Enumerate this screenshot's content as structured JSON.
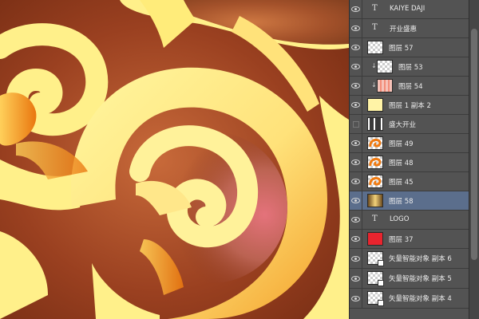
{
  "layers": [
    {
      "name": "KAIYE DAJI",
      "kind": "text",
      "visible": true
    },
    {
      "name": "开业盛惠",
      "kind": "text",
      "visible": true
    },
    {
      "name": "图层 57",
      "kind": "image",
      "thumb": "checker",
      "visible": true
    },
    {
      "name": "图层 53",
      "kind": "image",
      "thumb": "checker",
      "clipped": true,
      "visible": true
    },
    {
      "name": "图层 54",
      "kind": "image",
      "thumb": "pink-stripes",
      "clipped": true,
      "visible": true
    },
    {
      "name": "图层 1 副本 2",
      "kind": "image",
      "thumb": "yellow",
      "visible": true
    },
    {
      "name": "盛大开业",
      "kind": "image",
      "thumb": "dark-text",
      "visible": false
    },
    {
      "name": "图层 49",
      "kind": "image",
      "thumb": "orange-swirl",
      "visible": true
    },
    {
      "name": "图层 48",
      "kind": "image",
      "thumb": "orange-swirl",
      "visible": true
    },
    {
      "name": "图层 45",
      "kind": "image",
      "thumb": "orange-swirl",
      "visible": true
    },
    {
      "name": "图层 58",
      "kind": "image",
      "thumb": "gold-text",
      "visible": true,
      "selected": true
    },
    {
      "name": "LOGO",
      "kind": "text",
      "visible": true
    },
    {
      "name": "图层 37",
      "kind": "image",
      "thumb": "red",
      "visible": true
    },
    {
      "name": "矢量智能对象 副本 6",
      "kind": "smart",
      "thumb": "checker",
      "visible": true
    },
    {
      "name": "矢量智能对象 副本 5",
      "kind": "smart",
      "thumb": "checker",
      "visible": true
    },
    {
      "name": "矢量智能对象 副本 4",
      "kind": "smart",
      "thumb": "checker",
      "visible": true
    }
  ],
  "colors": {
    "panel_bg": "#535353",
    "selected_row": "#5b6e8c",
    "canvas_cream": "#fff08a",
    "canvas_brown": "#8b3a1e",
    "canvas_orange": "#f08a1a"
  }
}
